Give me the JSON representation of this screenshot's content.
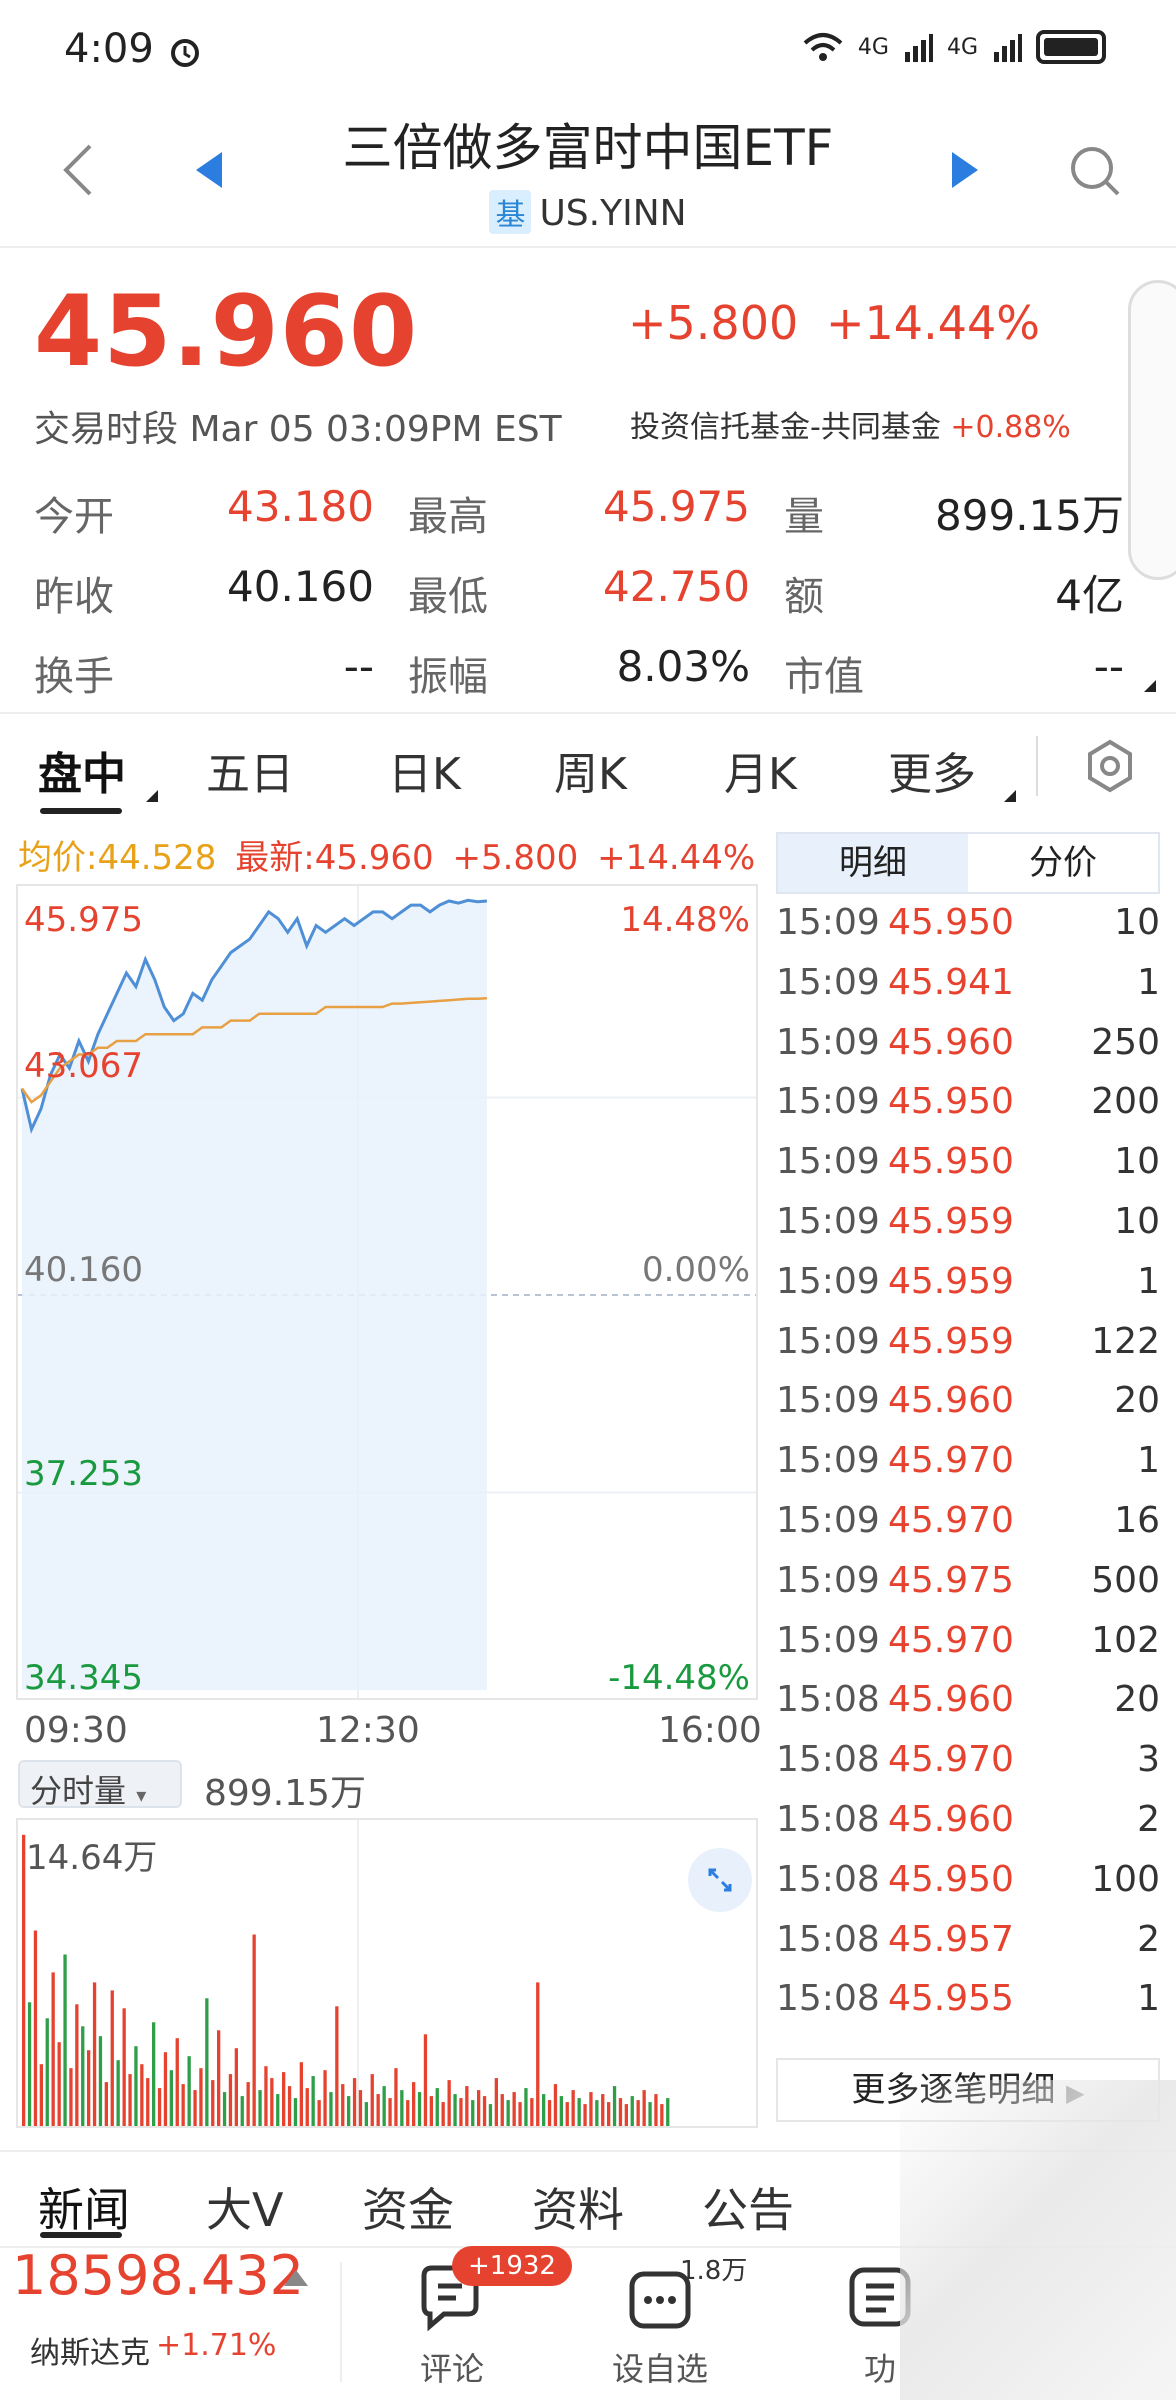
{
  "status_bar": {
    "time": "4:09",
    "net1": "4G",
    "net2": "4G"
  },
  "header": {
    "title": "三倍做多富时中国ETF",
    "tag": "基",
    "code": "US.YINN"
  },
  "quote": {
    "price": "45.960",
    "change": "+5.800",
    "change_pct": "+14.44%",
    "session": "交易时段 Mar 05 03:09PM EST",
    "sector": "投资信托基金-共同基金",
    "sector_pct": "+0.88%"
  },
  "stats": [
    {
      "label": "今开",
      "value": "43.180",
      "color": "red"
    },
    {
      "label": "最高",
      "value": "45.975",
      "color": "red"
    },
    {
      "label": "量",
      "value": "899.15万",
      "color": "dark"
    },
    {
      "label": "昨收",
      "value": "40.160",
      "color": "dark"
    },
    {
      "label": "最低",
      "value": "42.750",
      "color": "red"
    },
    {
      "label": "额",
      "value": "4亿",
      "color": "dark"
    },
    {
      "label": "换手",
      "value": "--",
      "color": "dark"
    },
    {
      "label": "振幅",
      "value": "8.03%",
      "color": "dark"
    },
    {
      "label": "市值",
      "value": "--",
      "color": "dark"
    }
  ],
  "tabs": [
    "盘中",
    "五日",
    "日K",
    "周K",
    "月K",
    "更多"
  ],
  "legend": {
    "avg": "均价:44.528",
    "latest": "最新:45.960",
    "chg": "+5.800",
    "pct": "+14.44%"
  },
  "chart_data": {
    "type": "line",
    "series": [
      {
        "name": "最新",
        "values": [
          43.2,
          42.6,
          42.9,
          43.4,
          43.7,
          43.5,
          43.9,
          43.6,
          44.0,
          44.3,
          44.6,
          44.9,
          44.7,
          45.1,
          44.8,
          44.4,
          44.2,
          44.3,
          44.6,
          44.5,
          44.8,
          45.0,
          45.2,
          45.3,
          45.4,
          45.6,
          45.8,
          45.7,
          45.5,
          45.7,
          45.3,
          45.6,
          45.5,
          45.6,
          45.7,
          45.6,
          45.7,
          45.8,
          45.8,
          45.7,
          45.8,
          45.9,
          45.9,
          45.8,
          45.9,
          45.96,
          45.93,
          45.97,
          45.95,
          45.96
        ]
      },
      {
        "name": "均价",
        "values": [
          43.2,
          43.0,
          43.1,
          43.3,
          43.5,
          43.6,
          43.7,
          43.7,
          43.8,
          43.8,
          43.9,
          43.9,
          43.9,
          44.0,
          44.0,
          44.0,
          44.0,
          44.0,
          44.0,
          44.1,
          44.1,
          44.1,
          44.2,
          44.2,
          44.2,
          44.3,
          44.3,
          44.3,
          44.3,
          44.3,
          44.3,
          44.3,
          44.4,
          44.4,
          44.4,
          44.4,
          44.4,
          44.4,
          44.4,
          44.45,
          44.45,
          44.46,
          44.47,
          44.48,
          44.49,
          44.5,
          44.51,
          44.52,
          44.52,
          44.528
        ]
      }
    ],
    "y_ticks": [
      {
        "value": "45.975",
        "pct": "14.48%",
        "color": "red"
      },
      {
        "value": "43.067",
        "pct": "",
        "color": "red"
      },
      {
        "value": "40.160",
        "pct": "0.00%",
        "color": "gray"
      },
      {
        "value": "37.253",
        "pct": "",
        "color": "green"
      },
      {
        "value": "34.345",
        "pct": "-14.48%",
        "color": "green"
      }
    ],
    "ylim": [
      34.345,
      45.975
    ],
    "x_ticks": [
      "09:30",
      "12:30",
      "16:00"
    ]
  },
  "volume": {
    "selector": "分时量",
    "total": "899.15万",
    "max": "14.64万",
    "bars": [
      14.6,
      6.2,
      9.8,
      3.1,
      5.4,
      7.7,
      4.2,
      8.6,
      2.9,
      6.1,
      5.0,
      3.8,
      7.2,
      4.5,
      2.2,
      6.8,
      3.3,
      5.9,
      2.6,
      4.0,
      3.1,
      2.4,
      5.2,
      1.9,
      3.7,
      2.8,
      4.4,
      2.1,
      3.5,
      1.8,
      2.9,
      6.4,
      2.3,
      4.8,
      1.7,
      2.6,
      3.9,
      1.5,
      2.2,
      9.6,
      1.8,
      3.0,
      2.4,
      1.6,
      2.7,
      2.0,
      1.4,
      3.2,
      1.9,
      2.5,
      1.3,
      2.8,
      1.7,
      6.0,
      2.1,
      1.5,
      2.4,
      1.8,
      1.2,
      2.6,
      1.6,
      2.0,
      1.4,
      2.9,
      1.8,
      1.3,
      2.2,
      1.7,
      4.6,
      1.5,
      1.9,
      1.2,
      2.3,
      1.6,
      1.4,
      2.0,
      1.3,
      1.8,
      1.5,
      1.1,
      2.4,
      1.6,
      1.3,
      1.7,
      1.2,
      1.9,
      1.4,
      7.2,
      1.6,
      1.3,
      2.1,
      1.5,
      1.2,
      1.8,
      1.4,
      1.1,
      1.7,
      1.3,
      1.6,
      1.2,
      2.0,
      1.4,
      1.1,
      1.5,
      1.3,
      1.8,
      1.2,
      1.6,
      1.1,
      1.4
    ]
  },
  "ticks_panel": {
    "tabs": [
      "明细",
      "分价"
    ],
    "rows": [
      [
        "15:09",
        "45.950",
        "10"
      ],
      [
        "15:09",
        "45.941",
        "1"
      ],
      [
        "15:09",
        "45.960",
        "250"
      ],
      [
        "15:09",
        "45.950",
        "200"
      ],
      [
        "15:09",
        "45.950",
        "10"
      ],
      [
        "15:09",
        "45.959",
        "10"
      ],
      [
        "15:09",
        "45.959",
        "1"
      ],
      [
        "15:09",
        "45.959",
        "122"
      ],
      [
        "15:09",
        "45.960",
        "20"
      ],
      [
        "15:09",
        "45.970",
        "1"
      ],
      [
        "15:09",
        "45.970",
        "16"
      ],
      [
        "15:09",
        "45.975",
        "500"
      ],
      [
        "15:09",
        "45.970",
        "102"
      ],
      [
        "15:08",
        "45.960",
        "20"
      ],
      [
        "15:08",
        "45.970",
        "3"
      ],
      [
        "15:08",
        "45.960",
        "2"
      ],
      [
        "15:08",
        "45.950",
        "100"
      ],
      [
        "15:08",
        "45.957",
        "2"
      ],
      [
        "15:08",
        "45.955",
        "1"
      ]
    ],
    "more": "更多逐笔明细"
  },
  "news_tabs": [
    "新闻",
    "大V",
    "资金",
    "资料",
    "公告"
  ],
  "bottom": {
    "index_value": "18598.432",
    "index_name": "纳斯达克",
    "index_pct": "+1.71%",
    "comments_badge": "+1932",
    "comments": "评论",
    "watch_count": "1.8万",
    "watch": "设自选",
    "func": "功"
  }
}
